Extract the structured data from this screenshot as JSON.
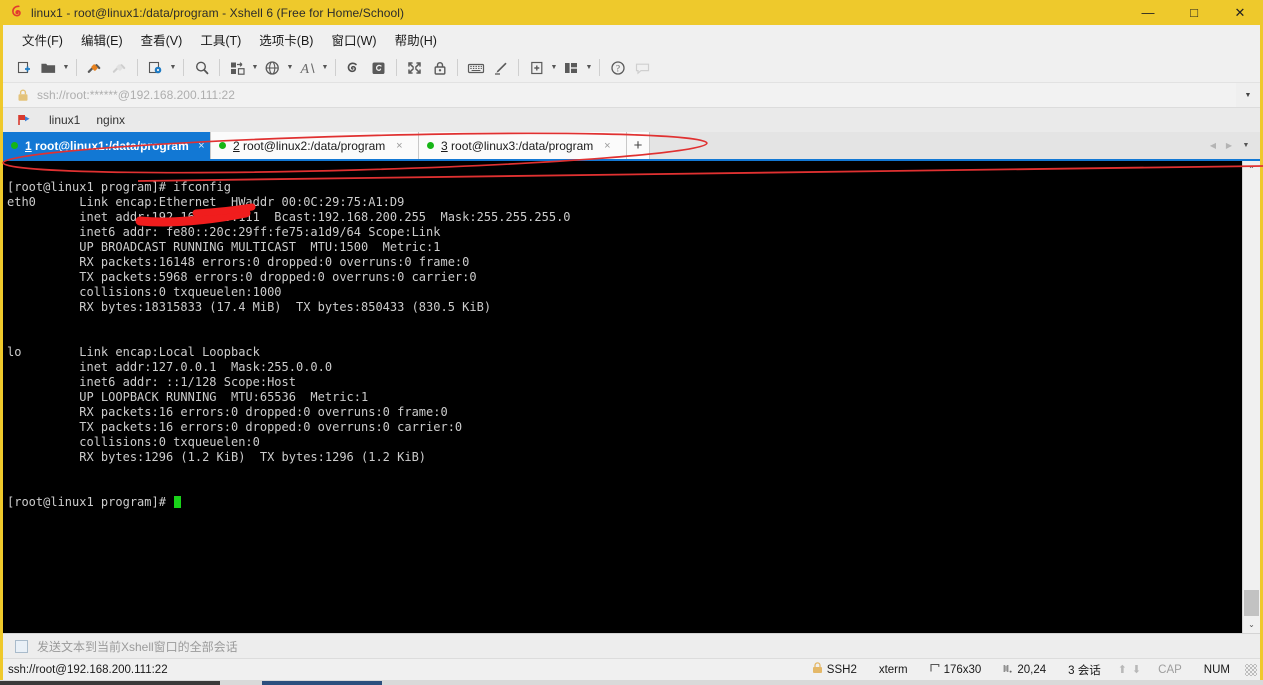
{
  "window": {
    "title": "linux1 - root@linux1:/data/program - Xshell 6 (Free for Home/School)",
    "app_icon": "xshell-logo-icon",
    "minimize_label": "—",
    "maximize_label": "□",
    "close_label": "✕",
    "titlebar_color": "#eec92c"
  },
  "menubar": {
    "items": [
      {
        "label": "文件(F)",
        "name": "menu-file"
      },
      {
        "label": "编辑(E)",
        "name": "menu-edit"
      },
      {
        "label": "查看(V)",
        "name": "menu-view"
      },
      {
        "label": "工具(T)",
        "name": "menu-tools"
      },
      {
        "label": "选项卡(B)",
        "name": "menu-tabs"
      },
      {
        "label": "窗口(W)",
        "name": "menu-window"
      },
      {
        "label": "帮助(H)",
        "name": "menu-help"
      }
    ]
  },
  "toolbar": {
    "caret": "▼",
    "buttons": [
      {
        "icon": "new-session-icon",
        "has_caret": false,
        "disabled": false
      },
      {
        "icon": "open-folder-icon",
        "has_caret": true,
        "disabled": false
      },
      {
        "icon": "connect-plug-icon",
        "has_caret": false,
        "disabled": false
      },
      {
        "icon": "disconnect-plug-icon",
        "has_caret": false,
        "disabled": true
      },
      {
        "icon": "session-properties-icon",
        "has_caret": true,
        "disabled": false
      },
      {
        "icon": "find-magnifier-icon",
        "has_caret": false,
        "disabled": false
      },
      {
        "icon": "file-transfer-icon",
        "has_caret": true,
        "disabled": false
      },
      {
        "icon": "globe-encoding-icon",
        "has_caret": true,
        "disabled": false
      },
      {
        "icon": "font-size-icon",
        "has_caret": true,
        "disabled": false
      },
      {
        "icon": "xftp-icon",
        "has_caret": false,
        "disabled": false
      },
      {
        "icon": "xshell-script-icon",
        "has_caret": false,
        "disabled": false
      },
      {
        "icon": "fullscreen-icon",
        "has_caret": false,
        "disabled": false
      },
      {
        "icon": "lock-icon",
        "has_caret": false,
        "disabled": false
      },
      {
        "icon": "keyboard-icon",
        "has_caret": false,
        "disabled": false
      },
      {
        "icon": "highlight-pen-icon",
        "has_caret": false,
        "disabled": false
      },
      {
        "icon": "new-tab-icon",
        "has_caret": true,
        "disabled": false
      },
      {
        "icon": "layout-arrange-icon",
        "has_caret": true,
        "disabled": false
      },
      {
        "icon": "help-icon",
        "has_caret": false,
        "disabled": false
      },
      {
        "icon": "chat-balloon-icon",
        "has_caret": false,
        "disabled": true
      }
    ]
  },
  "address_bar": {
    "lock_icon": "padlock-icon",
    "value": "ssh://root:******@192.168.200.111:22",
    "placeholder": "ssh://root:******@192.168.200.111:22",
    "dropdown": "▼"
  },
  "quickbar": {
    "icon": "bookmark-flag-icon",
    "items": [
      {
        "label": "linux1",
        "name": "quickbar-item-linux1"
      },
      {
        "label": "nginx",
        "name": "quickbar-item-nginx"
      }
    ]
  },
  "tabs": {
    "add_label": "+",
    "close_label": "×",
    "prev_label": "◀",
    "next_label": "▶",
    "list_label": "▼",
    "items": [
      {
        "index": "1",
        "label": " root@linux1:/data/program",
        "active": true,
        "status": "connected"
      },
      {
        "index": "2",
        "label": " root@linux2:/data/program",
        "active": false,
        "status": "connected"
      },
      {
        "index": "3",
        "label": " root@linux3:/data/program",
        "active": false,
        "status": "connected"
      }
    ]
  },
  "terminal": {
    "prompt_line": "[root@linux1 program]# ifconfig",
    "lines": [
      "[root@linux1 program]# ifconfig",
      "eth0      Link encap:Ethernet  HWaddr 00:0C:29:75:A1:D9",
      "          inet addr:192.168.200.111  Bcast:192.168.200.255  Mask:255.255.255.0",
      "          inet6 addr: fe80::20c:29ff:fe75:a1d9/64 Scope:Link",
      "          UP BROADCAST RUNNING MULTICAST  MTU:1500  Metric:1",
      "          RX packets:16148 errors:0 dropped:0 overruns:0 frame:0",
      "          TX packets:5968 errors:0 dropped:0 overruns:0 carrier:0",
      "          collisions:0 txqueuelen:1000",
      "          RX bytes:18315833 (17.4 MiB)  TX bytes:850433 (830.5 KiB)",
      "",
      "lo        Link encap:Local Loopback",
      "          inet addr:127.0.0.1  Mask:255.0.0.0",
      "          inet6 addr: ::1/128 Scope:Host",
      "          UP LOOPBACK RUNNING  MTU:65536  Metric:1",
      "          RX packets:16 errors:0 dropped:0 overruns:0 frame:0",
      "          TX packets:16 errors:0 dropped:0 overruns:0 carrier:0",
      "          collisions:0 txqueuelen:0",
      "          RX bytes:1296 (1.2 KiB)  TX bytes:1296 (1.2 KiB)",
      ""
    ],
    "final_prompt": "[root@linux1 program]# ",
    "background": "#000000",
    "foreground": "#cccccc",
    "cursor_color": "#19d219",
    "scroll_up": "⌃",
    "scroll_down": "⌄"
  },
  "send_bar": {
    "label": "发送文本到当前Xshell窗口的全部会话",
    "checkbox_checked": false
  },
  "status_bar": {
    "connection": "ssh://root@192.168.200.111:22",
    "lock_icon": "padlock-icon",
    "protocol": "SSH2",
    "term_type": "xterm",
    "size_icon": "resize-icon",
    "size": "176x30",
    "cursor_icon": "cursor-pos-icon",
    "cursor_pos": "20,24",
    "sessions": "3 会话",
    "up_arrow": "⬆",
    "down_arrow": "⬇",
    "cap": "CAP",
    "num": "NUM"
  },
  "annotations": {
    "ellipse_color": "#e03131",
    "strike_color": "#e03131",
    "notes": [
      {
        "name": "tabs-ellipse-annotation",
        "shape": "ellipse"
      },
      {
        "name": "ifconfig-strikethrough-annotation",
        "shape": "line"
      },
      {
        "name": "ipv6-redaction-annotation",
        "shape": "thick-line"
      }
    ]
  }
}
